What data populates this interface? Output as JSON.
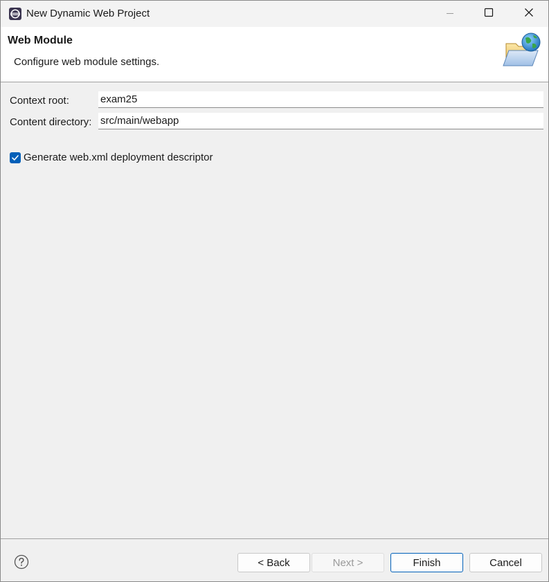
{
  "window": {
    "title": "New Dynamic Web Project",
    "app_icon": "eclipse-icon",
    "controls": {
      "minimize": "minimize-icon",
      "maximize": "maximize-icon",
      "close": "close-icon"
    }
  },
  "banner": {
    "title": "Web Module",
    "description": "Configure web module settings.",
    "icon": "web-folder-icon"
  },
  "form": {
    "context_root": {
      "label": "Context root:",
      "value": "exam25"
    },
    "content_directory": {
      "label": "Content directory:",
      "value": "src/main/webapp"
    },
    "generate_web_xml": {
      "label": "Generate web.xml deployment descriptor",
      "checked": true
    }
  },
  "footer": {
    "help_icon": "help-icon",
    "back_label": "< Back",
    "next_label": "Next >",
    "finish_label": "Finish",
    "cancel_label": "Cancel",
    "next_enabled": false,
    "default_button": "finish"
  },
  "colors": {
    "accent": "#005fb8",
    "window_bg": "#f0f0f0",
    "banner_bg": "#ffffff",
    "disabled_text": "#9a9a9a"
  }
}
